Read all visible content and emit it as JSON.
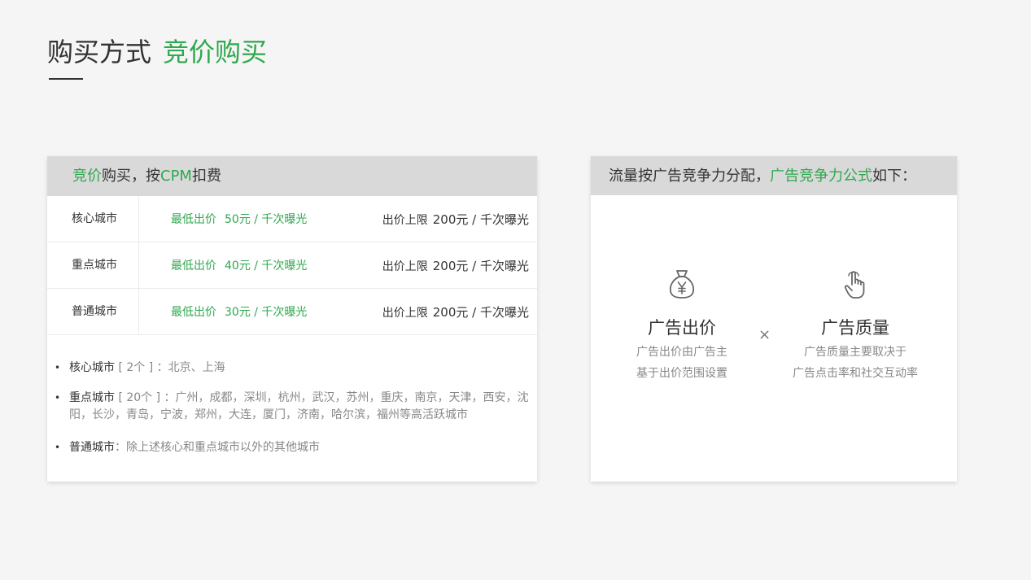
{
  "title": {
    "main": "购买方式",
    "highlight": "竞价购买"
  },
  "left_card": {
    "header": {
      "green1": "竞价",
      "text1": "购买，按",
      "green2": "CPM",
      "text2": "扣费"
    },
    "rows": [
      {
        "city": "核心城市",
        "min_label": "最低出价",
        "min_value": "50元 / 千次曝光",
        "max_label": "出价上限",
        "max_value": "200元 / 千次曝光"
      },
      {
        "city": "重点城市",
        "min_label": "最低出价",
        "min_value": "40元 / 千次曝光",
        "max_label": "出价上限",
        "max_value": "200元 / 千次曝光"
      },
      {
        "city": "普通城市",
        "min_label": "最低出价",
        "min_value": "30元 / 千次曝光",
        "max_label": "出价上限",
        "max_value": "200元 / 千次曝光"
      }
    ],
    "notes": [
      {
        "bullet": "•",
        "label": "核心城市",
        "text": " [ 2个 ] ：北京、上海"
      },
      {
        "bullet": "•",
        "label": "重点城市",
        "text": " [ 20个 ] ：广州，成都，深圳，杭州，武汉，苏州，重庆，南京，天津，西安，沈阳，长沙，青岛，宁波，郑州，大连，厦门，济南，哈尔滨，福州等高活跃城市"
      },
      {
        "bullet": "•",
        "label": "普通城市",
        "text": "：除上述核心和重点城市以外的其他城市"
      }
    ]
  },
  "right_card": {
    "header": {
      "text1": "流量按广告竞争力分配，",
      "green": "广告竞争力公式",
      "text2": "如下："
    },
    "bid": {
      "icon": "money-bag-icon",
      "title": "广告出价",
      "desc1": "广告出价由广告主",
      "desc2": "基于出价范围设置"
    },
    "operator": "×",
    "quality": {
      "icon": "hand-pointer-icon",
      "title": "广告质量",
      "desc1": "广告质量主要取决于",
      "desc2": "广告点击率和社交互动率"
    }
  }
}
